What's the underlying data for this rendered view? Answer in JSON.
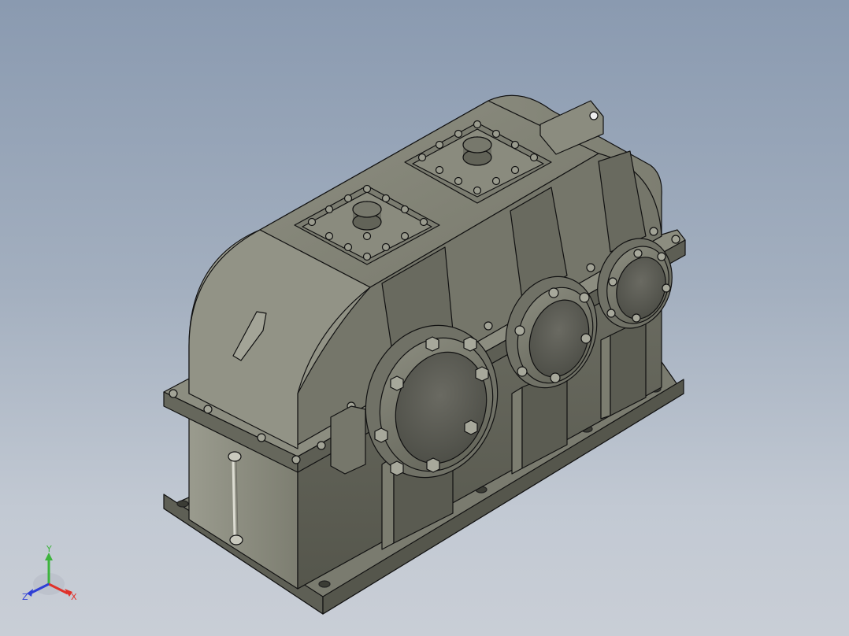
{
  "viewport": {
    "background_top": "#8a9ab0",
    "background_bottom": "#c9ced6",
    "model_color": "#6f6f63",
    "model_edge_color": "#000000"
  },
  "model": {
    "description_visible": false,
    "flanges": 3,
    "inspection_covers": 2,
    "icon": "helical-gearbox-3d-model"
  },
  "triad": {
    "x_label": "X",
    "y_label": "Y",
    "z_label": "Z",
    "x_color": "#e0312a",
    "y_color": "#3db43d",
    "z_color": "#2f3fd6"
  }
}
